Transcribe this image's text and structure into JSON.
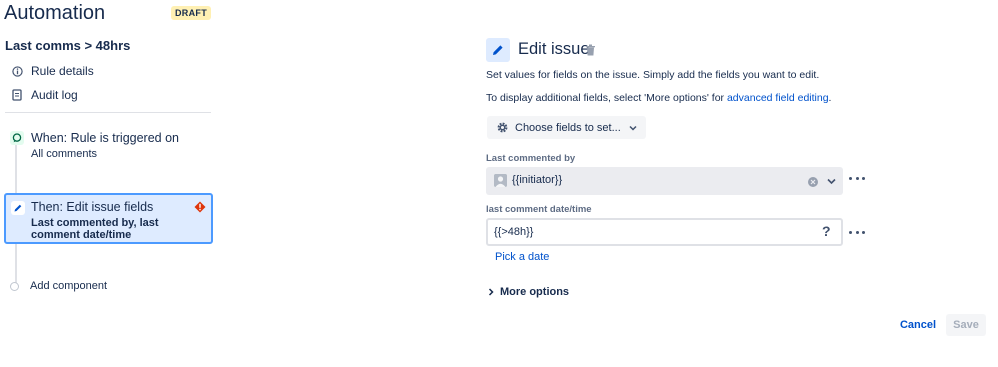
{
  "app": {
    "title": "Automation",
    "status_badge": "DRAFT"
  },
  "rule": {
    "name": "Last comms > 48hrs"
  },
  "nav": [
    {
      "label": "Rule details",
      "icon": "info-icon"
    },
    {
      "label": "Audit log",
      "icon": "document-icon"
    }
  ],
  "trigger": {
    "title": "When: Rule is triggered on",
    "subtitle": "All comments",
    "icon": "comment-trigger-icon"
  },
  "action": {
    "title": "Then: Edit issue fields",
    "subtitle": "Last commented by, last comment date/time",
    "icon": "pencil-icon",
    "warning_icon": "error-icon"
  },
  "add_component": {
    "label": "Add component"
  },
  "editor": {
    "title": "Edit issue",
    "description": "Set values for fields on the issue. Simply add the fields you want to edit.",
    "more_fields_prefix": "To display additional fields, select 'More options' for ",
    "more_fields_link": "advanced field editing",
    "more_fields_suffix": ".",
    "choose_fields_label": "Choose fields to set...",
    "fields": [
      {
        "label": "Last commented by",
        "value": "{{initiator}}"
      },
      {
        "label": "last comment date/time",
        "value": "{{>48h}}",
        "help": "?"
      }
    ],
    "pick_date_label": "Pick a date",
    "more_options_label": "More options"
  },
  "footer": {
    "cancel_label": "Cancel",
    "save_label": "Save"
  },
  "colors": {
    "accent": "#0052cc",
    "selected_border": "#4c9aff",
    "selected_bg": "#deebff",
    "draft_bg": "#fff0b3",
    "error": "#de350b"
  }
}
